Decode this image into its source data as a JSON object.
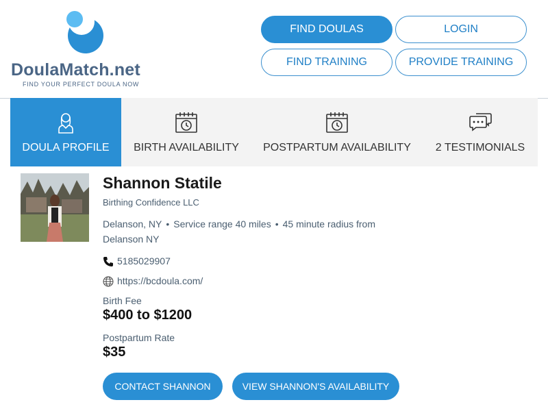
{
  "brand": {
    "name": "DoulaMatch.net",
    "tagline": "FIND YOUR PERFECT DOULA NOW",
    "colors": {
      "primary": "#2a8fd4",
      "text": "#4a6585"
    }
  },
  "nav": {
    "find_doulas": "FIND DOULAS",
    "login": "LOGIN",
    "find_training": "FIND TRAINING",
    "provide_training": "PROVIDE TRAINING"
  },
  "tabs": [
    {
      "label": "DOULA PROFILE",
      "icon": "person-icon",
      "active": true
    },
    {
      "label": "BIRTH AVAILABILITY",
      "icon": "calendar-clock-icon",
      "active": false
    },
    {
      "label": "POSTPARTUM AVAILABILITY",
      "icon": "calendar-clock-icon",
      "active": false
    },
    {
      "label": "2 TESTIMONIALS",
      "icon": "chat-bubbles-icon",
      "active": false
    }
  ],
  "profile": {
    "name": "Shannon Statile",
    "business": "Birthing Confidence LLC",
    "location": "Delanson, NY",
    "service_range": "Service range 40 miles",
    "radius_line1": "45 minute radius from",
    "radius_line2": "Delanson NY",
    "phone": "5185029907",
    "website": "https://bcdoula.com/",
    "birth_fee_label": "Birth Fee",
    "birth_fee": "$400 to $1200",
    "postpartum_rate_label": "Postpartum Rate",
    "postpartum_rate": "$35"
  },
  "actions": {
    "contact": "CONTACT SHANNON",
    "availability": "VIEW SHANNON'S AVAILABILITY"
  }
}
